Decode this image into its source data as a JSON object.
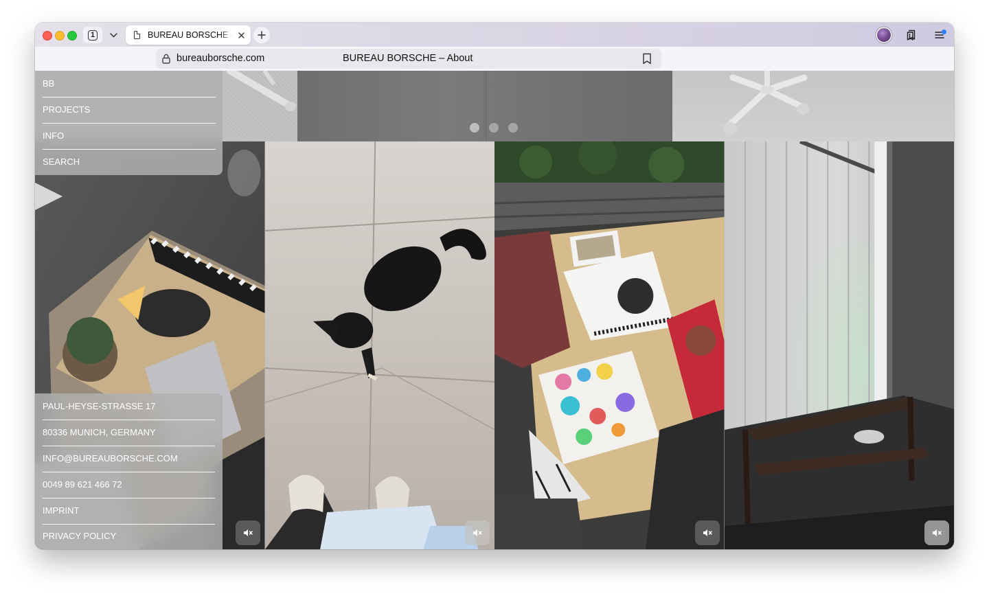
{
  "browser": {
    "tab_count": "1",
    "active_tab_title": "BUREAU BORSCHE – About",
    "url": "bureauborsche.com",
    "page_title": "BUREAU BORSCHE – About",
    "icons": [
      "traffic-lights",
      "tab-overview-icon",
      "chevron-down-icon",
      "document-icon",
      "close-icon",
      "plus-icon",
      "profile-avatar",
      "bookmarks-icon",
      "sidebar-menu-icon",
      "lock-icon",
      "bookmark-icon"
    ]
  },
  "nav": {
    "items": [
      "BB",
      "PROJECTS",
      "INFO",
      "SEARCH"
    ]
  },
  "hero_slider": {
    "dot_count": 3,
    "active_index": 1
  },
  "contact": {
    "items": [
      "PAUL-HEYSE-STRASSE 17",
      "80336 MUNICH, GERMANY",
      "INFO@BUREAUBORSCHE.COM",
      "0049 89 621 466 72",
      "IMPRINT",
      "PRIVACY POLICY"
    ]
  },
  "gallery": {
    "tiles": [
      {
        "subject": "magazine-on-table",
        "mute_icon": "speaker-muted-icon"
      },
      {
        "subject": "dog-on-terrazzo-floor",
        "mute_icon": "speaker-muted-icon"
      },
      {
        "subject": "stickers-and-books-on-table",
        "mute_icon": "speaker-muted-icon"
      },
      {
        "subject": "window-with-blinds-and-bench",
        "mute_icon": "speaker-muted-icon"
      }
    ]
  },
  "colors": {
    "overlay_panel": "#b0b0b0",
    "overlay_text": "#ffffff",
    "tab_bar": "#dcd9e4",
    "traffic_red": "#fe5f57",
    "traffic_yellow": "#febc2e",
    "traffic_green": "#28c840",
    "notification_dot": "#2f7cf6"
  }
}
